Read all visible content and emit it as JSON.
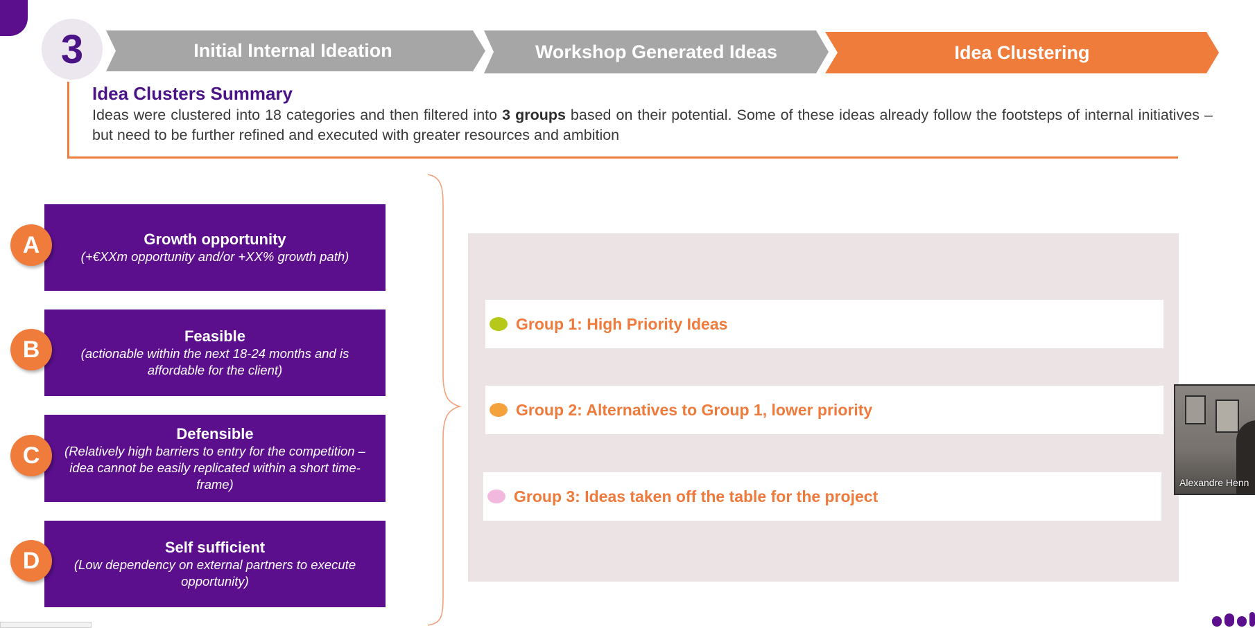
{
  "header": {
    "step_number": "3",
    "steps": [
      {
        "label": "Initial Internal Ideation",
        "state": "done"
      },
      {
        "label": "Workshop Generated Ideas",
        "state": "done"
      },
      {
        "label": "Idea Clustering",
        "state": "active"
      }
    ]
  },
  "summary": {
    "title": "Idea Clusters Summary",
    "text_before": "Ideas were clustered into 18 categories and then filtered into ",
    "text_bold": "3 groups",
    "text_after": " based on their potential. Some of these ideas already follow the footsteps of internal initiatives – but need to be further refined and executed with greater resources and ambition"
  },
  "criteria": [
    {
      "letter": "A",
      "title": "Growth opportunity",
      "subtitle": "(+€XXm opportunity and/or +XX% growth path)"
    },
    {
      "letter": "B",
      "title": "Feasible",
      "subtitle": "(actionable within the next 18-24 months and is affordable for the client)"
    },
    {
      "letter": "C",
      "title": "Defensible",
      "subtitle": "(Relatively high barriers to entry for the competition – idea cannot be easily replicated within a short time-frame)"
    },
    {
      "letter": "D",
      "title": "Self sufficient",
      "subtitle": "(Low dependency on external partners to execute opportunity)"
    }
  ],
  "groups": [
    {
      "label": "Group 1: High Priority Ideas",
      "dot_color": "#b6c91b"
    },
    {
      "label": "Group 2: Alternatives to Group 1, lower priority",
      "dot_color": "#f4a23c"
    },
    {
      "label": "Group 3: Ideas taken off the table for the project",
      "dot_color": "#f2b8dd"
    }
  ],
  "video": {
    "participant_name": "Alexandre Henn"
  },
  "colors": {
    "purple": "#5b0f8c",
    "orange": "#f07c3c",
    "grey": "#a6a6a6"
  }
}
